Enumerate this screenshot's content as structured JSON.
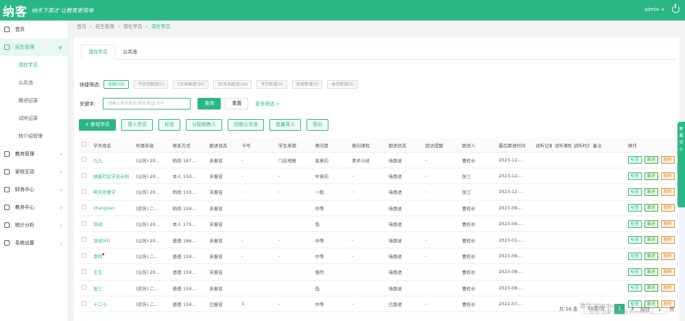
{
  "app": {
    "logo": "纳客",
    "slogan": "纳天下英才 让教育更简单",
    "user": "admin ∨"
  },
  "sidebar": {
    "items": [
      {
        "label": "首页",
        "arrow": ""
      },
      {
        "label": "招生管理",
        "arrow": "∨"
      }
    ],
    "sub": [
      "潜在学员",
      "公共池",
      "跟进记录",
      "试听记录",
      "转介绍管理"
    ],
    "rest": [
      {
        "label": "教务管理",
        "arrow": "›"
      },
      {
        "label": "家校互动",
        "arrow": "›"
      },
      {
        "label": "财务中心",
        "arrow": "›"
      },
      {
        "label": "教务中心",
        "arrow": "›"
      },
      {
        "label": "统计分析",
        "arrow": "›"
      },
      {
        "label": "系统设置",
        "arrow": "›"
      }
    ]
  },
  "breadcrumb": [
    "首页",
    "招生管理",
    "潜在学员",
    "潜在学员"
  ],
  "tabs": [
    "潜在学员",
    "公共池"
  ],
  "filter": {
    "label": "快捷筛选:",
    "chips": [
      "全部(16)",
      "今日待跟进(0)",
      "7天未跟进(16)",
      "30天未跟进(16)",
      "今日新增(0)",
      "本周新增(0)",
      "本月新增(0)"
    ]
  },
  "search": {
    "label": "关键字:",
    "placeholder": "请输入学员姓名/联系电话/卡号",
    "search_btn": "查询",
    "reset_btn": "重置",
    "more": "更多筛选 »"
  },
  "actions": [
    "+ 新增学员",
    "导入学员",
    "标签",
    "分配销售人",
    "回收公共池",
    "批量导入",
    "导出"
  ],
  "table": {
    "headers": [
      "",
      "学员姓名",
      "所属年级",
      "联系方式",
      "跟进状态",
      "卡号",
      "学生来源",
      "意向度",
      "意向课程",
      "跟进状态",
      "回访提醒",
      "跟进人",
      "最后跟进时间",
      "试听记录",
      "试听课程",
      "试听时间",
      "备注",
      "操作"
    ],
    "rows": [
      [
        "",
        "九九",
        "(公历) 20...",
        "妈妈 187...",
        "未报名",
        "-",
        "门店地推",
        "高意向",
        "美术小班",
        "待跟进",
        "-",
        "曹校长",
        "2023-12-...",
        "",
        "",
        "",
        "",
        ""
      ],
      [
        "",
        "纳客社区学员示例",
        "(公历) 20...",
        "本人 150...",
        "未报名",
        "-",
        "-",
        "中意向",
        "-",
        "待跟进",
        "-",
        "张三",
        "2023-12-...",
        "",
        "",
        "",
        "",
        ""
      ],
      [
        "",
        "明天也要学",
        "(公历) 20...",
        "妈妈 133...",
        "未报名",
        "-",
        "-",
        "一般",
        "-",
        "待跟进",
        "-",
        "张三",
        "2023-12-...",
        "",
        "",
        "",
        "",
        ""
      ],
      [
        "",
        "zhangsan",
        "(农历) 二...",
        "妈妈 159...",
        "未报名",
        "",
        "",
        "中等",
        "",
        "待跟进",
        "",
        "曹校长",
        "2023-09-...",
        "",
        "",
        "",
        "",
        ""
      ],
      [
        "",
        "测试",
        "(公历) 20...",
        "本人 175...",
        "未报名",
        "",
        "",
        "低",
        "",
        "待跟进",
        "",
        "曹校长",
        "2023-04-...",
        "",
        "",
        "",
        "",
        ""
      ],
      [
        "",
        "测试001",
        "(公历) 20...",
        "爸爸 186...",
        "未报名",
        "-",
        "-",
        "中等",
        "-",
        "待跟进",
        "-",
        "曹校长",
        "2023-01-...",
        "",
        "",
        "",
        "",
        ""
      ],
      [
        "",
        "李四",
        "(公历) 二...",
        "爸爸 159...",
        "未报名",
        "-",
        "-",
        "中等",
        "-",
        "待跟进",
        "-",
        "曹校长",
        "2023-06-...",
        "",
        "",
        "",
        "",
        ""
      ],
      [
        "",
        "王五",
        "(公历) 20...",
        "爸爸 159...",
        "未报名",
        "",
        "",
        "强烈",
        "",
        "待跟进",
        "",
        "曹校长",
        "2023-08-...",
        "",
        "",
        "",
        "",
        ""
      ],
      [
        "",
        "张三",
        "(农历) 二...",
        "爸爸 159...",
        "未报名",
        "",
        "",
        "低",
        "",
        "待跟进",
        "",
        "曹校长",
        "2023-08-...",
        "",
        "",
        "",
        "",
        ""
      ],
      [
        "",
        "十二小",
        "(农历) 二...",
        "爸爸 159...",
        "已报名",
        "1",
        "-",
        "中等",
        "-",
        "已跟进",
        "-",
        "曹校长",
        "2022-07-...",
        "",
        "",
        "",
        "",
        ""
      ]
    ],
    "ops": [
      "标签",
      "跟进",
      "删除"
    ]
  },
  "pager": {
    "total": "共 16 条",
    "size": "10条/页",
    "pages": [
      "1",
      "2"
    ],
    "goto": "前往",
    "goto_val": "1",
    "unit": "页"
  },
  "rail": "客服中心",
  "watermark": {
    "line1": "激活 Windows",
    "line2": "转到\"设置\"以激活 Windows。"
  },
  "colors": {
    "accent": "#2bb784"
  }
}
